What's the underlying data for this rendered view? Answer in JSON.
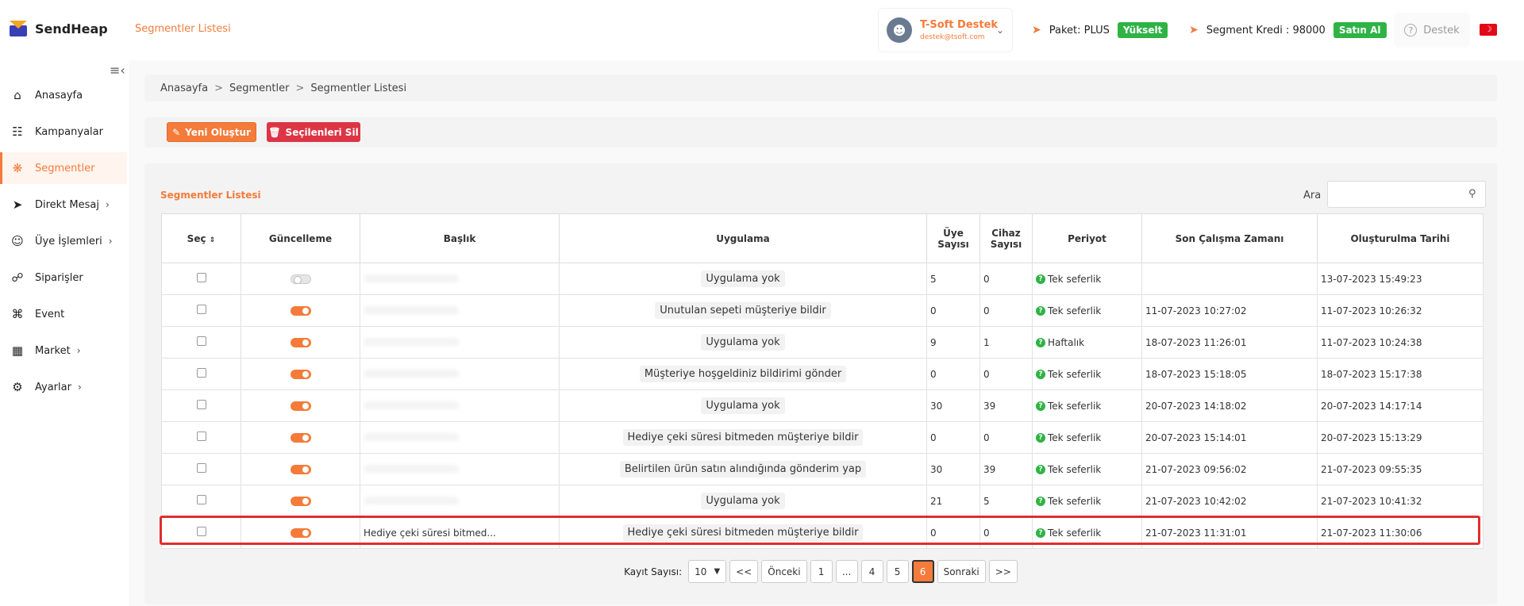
{
  "header": {
    "brand": "SendHeap",
    "page_title": "Segmentler Listesi",
    "user": {
      "name": "T-Soft Destek",
      "email": "destek@tsoft.com"
    },
    "package": {
      "label": "Paket: PLUS",
      "button": "Yükselt"
    },
    "credit": {
      "label": "Segment Kredi : 98000",
      "button": "Satın Al"
    },
    "help": "Destek"
  },
  "sidebar": {
    "items": [
      {
        "label": "Anasayfa",
        "icon": "home-icon"
      },
      {
        "label": "Kampanyalar",
        "icon": "megaphone-icon"
      },
      {
        "label": "Segmentler",
        "icon": "segment-icon"
      },
      {
        "label": "Direkt Mesaj",
        "icon": "send-icon"
      },
      {
        "label": "Üye İşlemleri",
        "icon": "users-icon"
      },
      {
        "label": "Siparişler",
        "icon": "cart-icon"
      },
      {
        "label": "Event",
        "icon": "command-icon"
      },
      {
        "label": "Market",
        "icon": "store-icon"
      },
      {
        "label": "Ayarlar",
        "icon": "gear-icon"
      }
    ]
  },
  "breadcrumb": {
    "home": "Anasayfa",
    "parent": "Segmentler",
    "current": "Segmentler Listesi"
  },
  "actions": {
    "create": "Yeni Oluştur",
    "delete": "Seçilenleri Sil"
  },
  "list": {
    "title": "Segmentler Listesi",
    "search_label": "Ara",
    "search_value": "",
    "columns": {
      "select": "Seç",
      "update": "Güncelleme",
      "title": "Başlık",
      "app": "Uygulama",
      "members_1": "Üye",
      "members_2": "Sayısı",
      "devices_1": "Cihaz",
      "devices_2": "Sayısı",
      "period": "Periyot",
      "last_run": "Son Çalışma Zamanı",
      "created": "Oluşturulma Tarihi"
    },
    "rows": [
      {
        "title": "",
        "app": "Uygulama yok",
        "members": "5",
        "devices": "0",
        "period": "Tek seferlik",
        "last_run": "",
        "created": "13-07-2023 15:49:23"
      },
      {
        "title": "",
        "app": "Unutulan sepeti müşteriye bildir",
        "members": "0",
        "devices": "0",
        "period": "Tek seferlik",
        "last_run": "11-07-2023 10:27:02",
        "created": "11-07-2023 10:26:32"
      },
      {
        "title": "",
        "app": "Uygulama yok",
        "members": "9",
        "devices": "1",
        "period": "Haftalık",
        "last_run": "18-07-2023 11:26:01",
        "created": "11-07-2023 10:24:38"
      },
      {
        "title": "",
        "app": "Müşteriye hoşgeldiniz bildirimi gönder",
        "members": "0",
        "devices": "0",
        "period": "Tek seferlik",
        "last_run": "18-07-2023 15:18:05",
        "created": "18-07-2023 15:17:38"
      },
      {
        "title": "",
        "app": "Uygulama yok",
        "members": "30",
        "devices": "39",
        "period": "Tek seferlik",
        "last_run": "20-07-2023 14:18:02",
        "created": "20-07-2023 14:17:14"
      },
      {
        "title": "",
        "app": "Hediye çeki süresi bitmeden müşteriye bildir",
        "members": "0",
        "devices": "0",
        "period": "Tek seferlik",
        "last_run": "20-07-2023 15:14:01",
        "created": "20-07-2023 15:13:29"
      },
      {
        "title": "",
        "app": "Belirtilen ürün satın alındığında gönderim yap",
        "members": "30",
        "devices": "39",
        "period": "Tek seferlik",
        "last_run": "21-07-2023 09:56:02",
        "created": "21-07-2023 09:55:35"
      },
      {
        "title": "",
        "app": "Uygulama yok",
        "members": "21",
        "devices": "5",
        "period": "Tek seferlik",
        "last_run": "21-07-2023 10:42:02",
        "created": "21-07-2023 10:41:32"
      },
      {
        "title": "Hediye çeki süresi bitmed...",
        "app": "Hediye çeki süresi bitmeden müşteriye bildir",
        "members": "0",
        "devices": "0",
        "period": "Tek seferlik",
        "last_run": "21-07-2023 11:31:01",
        "created": "21-07-2023 11:30:06"
      }
    ],
    "toggles": [
      false,
      true,
      true,
      true,
      true,
      true,
      true,
      true,
      true
    ]
  },
  "pagination": {
    "label": "Kayıt Sayısı:",
    "page_size": "10",
    "first": "<<",
    "prev": "Önceki",
    "pages": [
      "1",
      "...",
      "4",
      "5",
      "6"
    ],
    "active_page": "6",
    "next": "Sonraki",
    "last": ">>"
  },
  "colors": {
    "accent": "#f47b3a",
    "success": "#2fb344",
    "danger": "#dc3545",
    "highlight": "#e02d2d"
  }
}
